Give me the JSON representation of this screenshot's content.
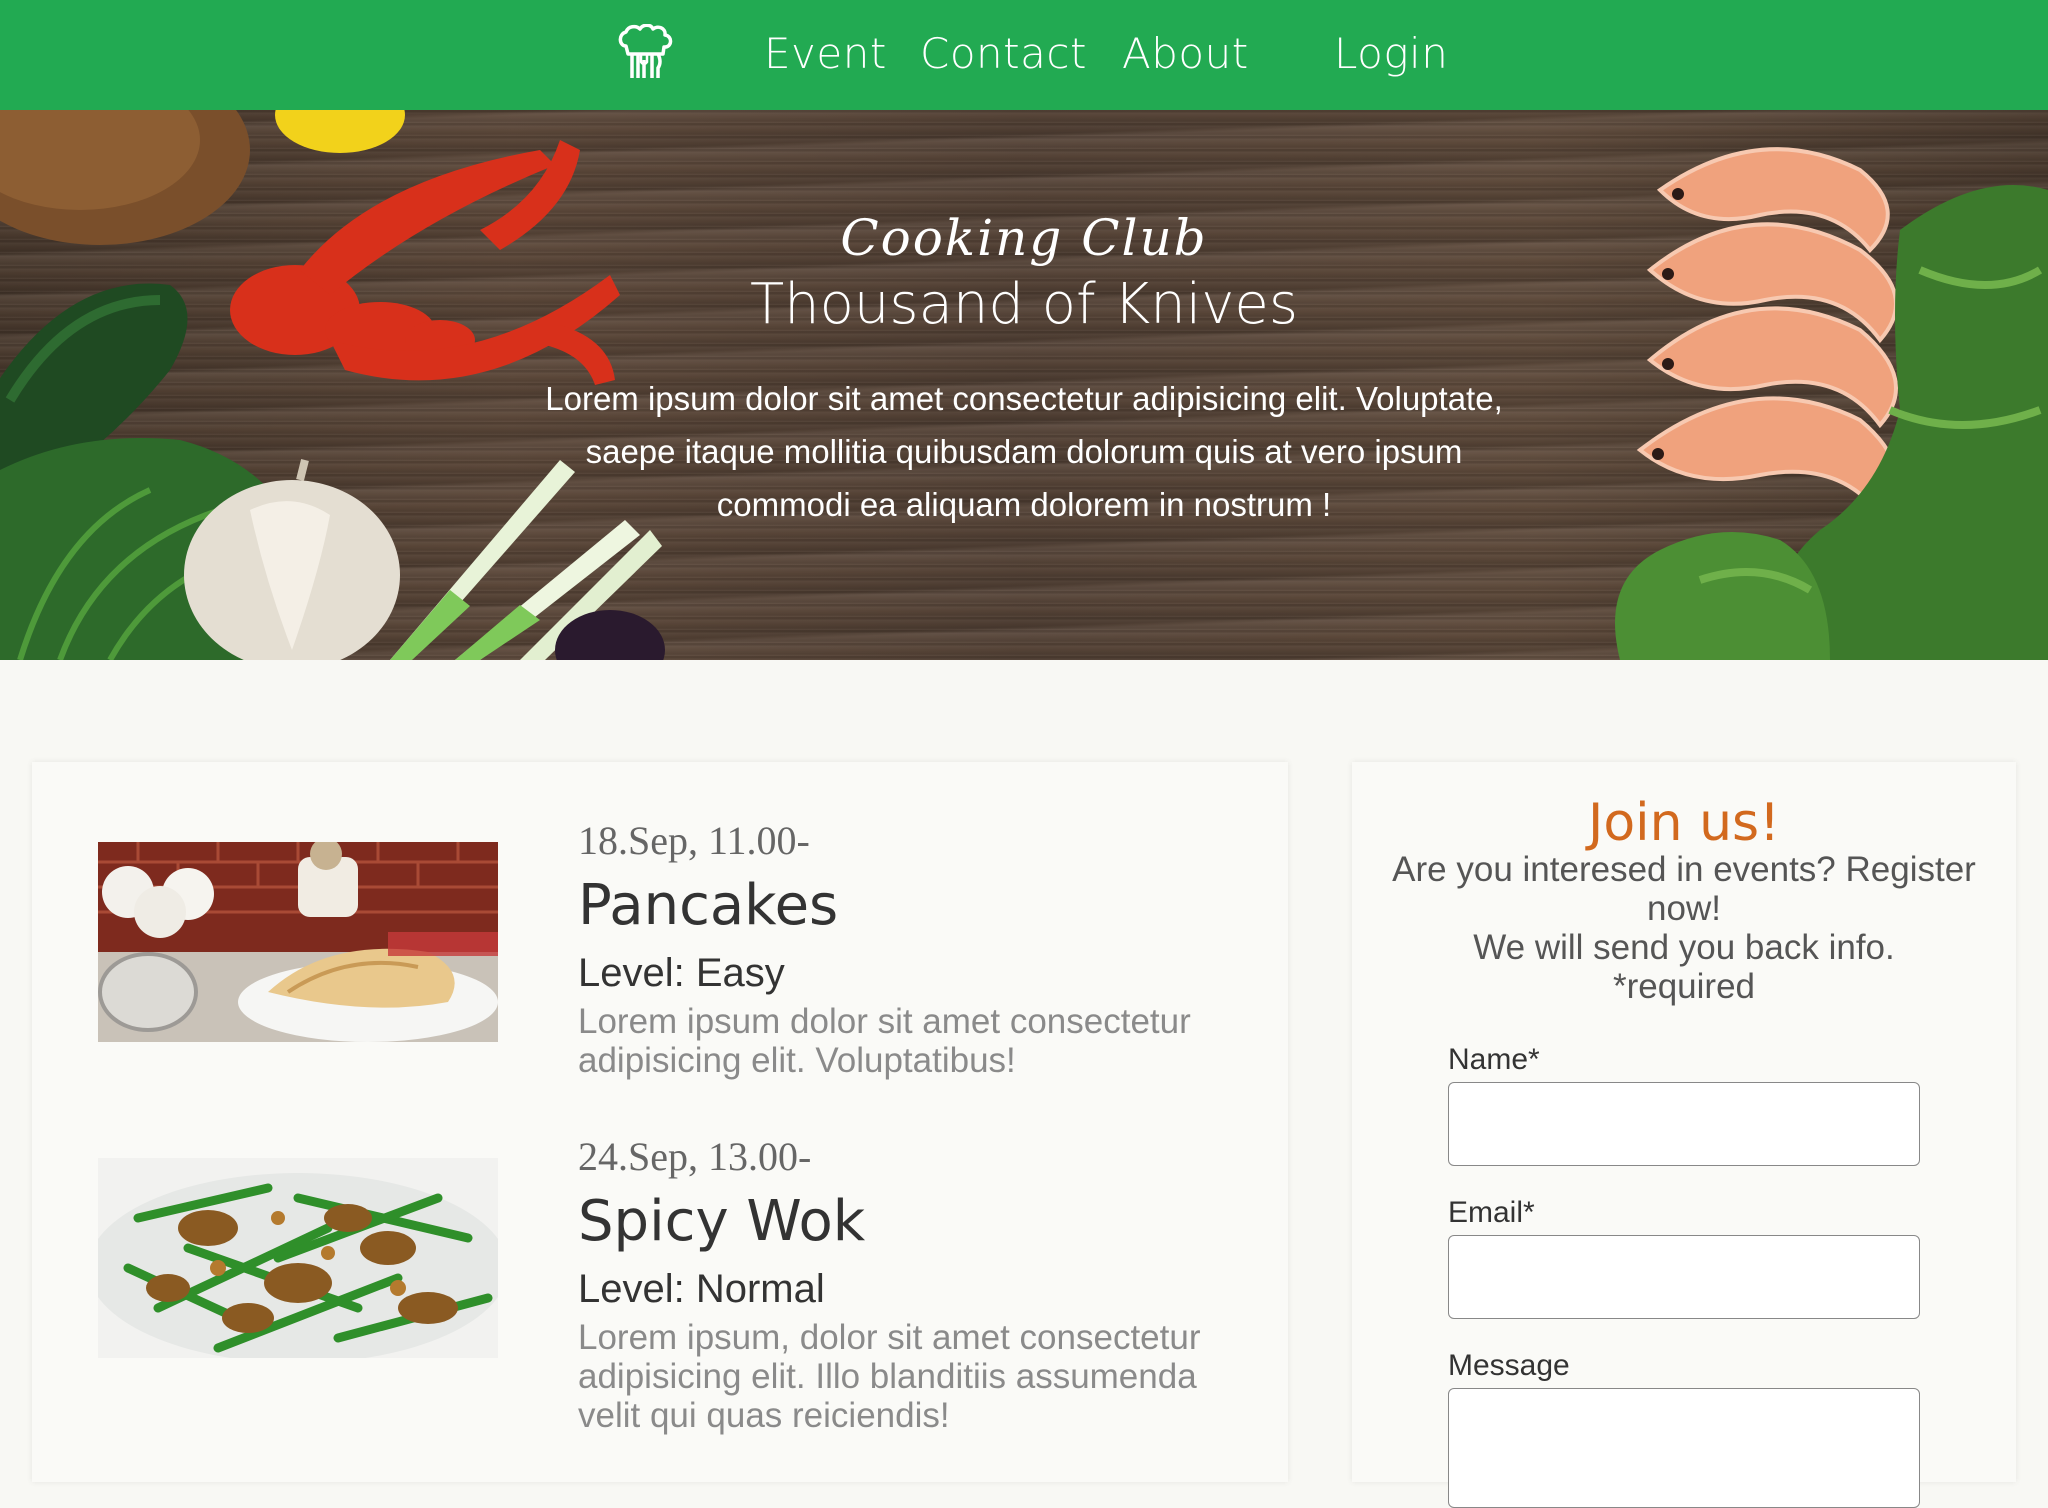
{
  "nav": {
    "logo_icon": "chef-hat-utensils-icon",
    "links": [
      "Event",
      "Contact",
      "About"
    ],
    "login": "Login"
  },
  "hero": {
    "script_title": "Cooking Club",
    "title": "Thousand of Knives",
    "text": "Lorem ipsum dolor sit amet consectetur adipisicing elit. Voluptate, saepe itaque mollitia quibusdam dolorum quis at vero ipsum commodi ea aliquam dolorem in nostrum !"
  },
  "events": [
    {
      "date": "18.Sep, 11.00-",
      "name": "Pancakes",
      "level": "Level: Easy",
      "description": "Lorem ipsum dolor sit amet consectetur adipisicing elit. Voluptatibus!",
      "image": "pancakes-photo"
    },
    {
      "date": "24.Sep, 13.00-",
      "name": "Spicy Wok",
      "level": "Level: Normal",
      "description": "Lorem ipsum, dolor sit amet consectetur adipisicing elit. Illo blanditiis assumenda velit qui quas reiciendis!",
      "image": "spicy-wok-photo"
    }
  ],
  "join": {
    "title": "Join us!",
    "line1": "Are you interesed in events? Register now!",
    "line2": "We will send you back info.",
    "line3": "*required",
    "name_label": "Name*",
    "email_label": "Email*",
    "message_label": "Message",
    "name_value": "",
    "email_value": "",
    "message_value": ""
  },
  "colors": {
    "nav_bg": "#22aa52",
    "join_title": "#d2691e",
    "page_bg": "#f8f8f4"
  }
}
